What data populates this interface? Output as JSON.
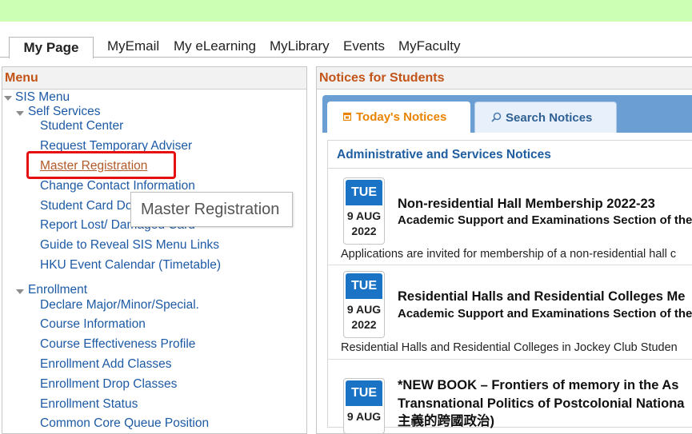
{
  "nav": {
    "tabs": [
      "My Page",
      "MyEmail",
      "My eLearning",
      "MyLibrary",
      "Events",
      "MyFaculty"
    ]
  },
  "menu": {
    "header": "Menu",
    "root": "SIS Menu",
    "self_services": {
      "label": "Self Services",
      "items": [
        "Student Center",
        "Request Temporary Adviser",
        "Master Registration",
        "Change Contact Information",
        "Student Card Do",
        "Report Lost/ Damaged Card",
        "Guide to Reveal SIS Menu Links",
        "HKU Event Calendar (Timetable)"
      ]
    },
    "enrollment": {
      "label": "Enrollment",
      "items": [
        "Declare Major/Minor/Special.",
        "Course Information",
        "Course Effectiveness Profile",
        "Enrollment Add Classes",
        "Enrollment Drop Classes",
        "Enrollment Status",
        "Common Core Queue Position"
      ]
    },
    "tooltip": "Master Registration"
  },
  "notices": {
    "header": "Notices for Students",
    "tabs": {
      "today": "Today's Notices",
      "search": "Search Notices"
    },
    "section_title": "Administrative and Services Notices",
    "items": [
      {
        "dow": "TUE",
        "daymonth": "9 AUG",
        "year": "2022",
        "title": "Non-residential Hall Membership 2022-23",
        "subtitle": "Academic Support and Examinations Section of the",
        "desc": "Applications are invited for membership of a non-residential hall c"
      },
      {
        "dow": "TUE",
        "daymonth": "9 AUG",
        "year": "2022",
        "title": "Residential Halls and Residential Colleges Me",
        "subtitle": "Academic Support and Examinations Section of the",
        "desc": "Residential Halls and Residential Colleges in Jockey Club Studen"
      },
      {
        "dow": "TUE",
        "daymonth": "9 AUG",
        "year": "",
        "title": "*NEW BOOK – Frontiers of memory in the As",
        "subtitle": "Transnational Politics of Postcolonial Nationa",
        "extra": "主義的跨國政治)"
      }
    ]
  },
  "colors": {
    "top_band": "#ccffb3",
    "panel_header_text": "#c35418",
    "link_blue": "#1d5aa5",
    "highlight_red": "#e61010",
    "date_blue": "#1b73c6",
    "tab_bar_blue": "#6b9ed3",
    "today_tab_text": "#e98300"
  },
  "icons": {
    "today_tab": "calendar-icon",
    "search_tab": "search-icon",
    "tree": "triangle-down-icon"
  }
}
